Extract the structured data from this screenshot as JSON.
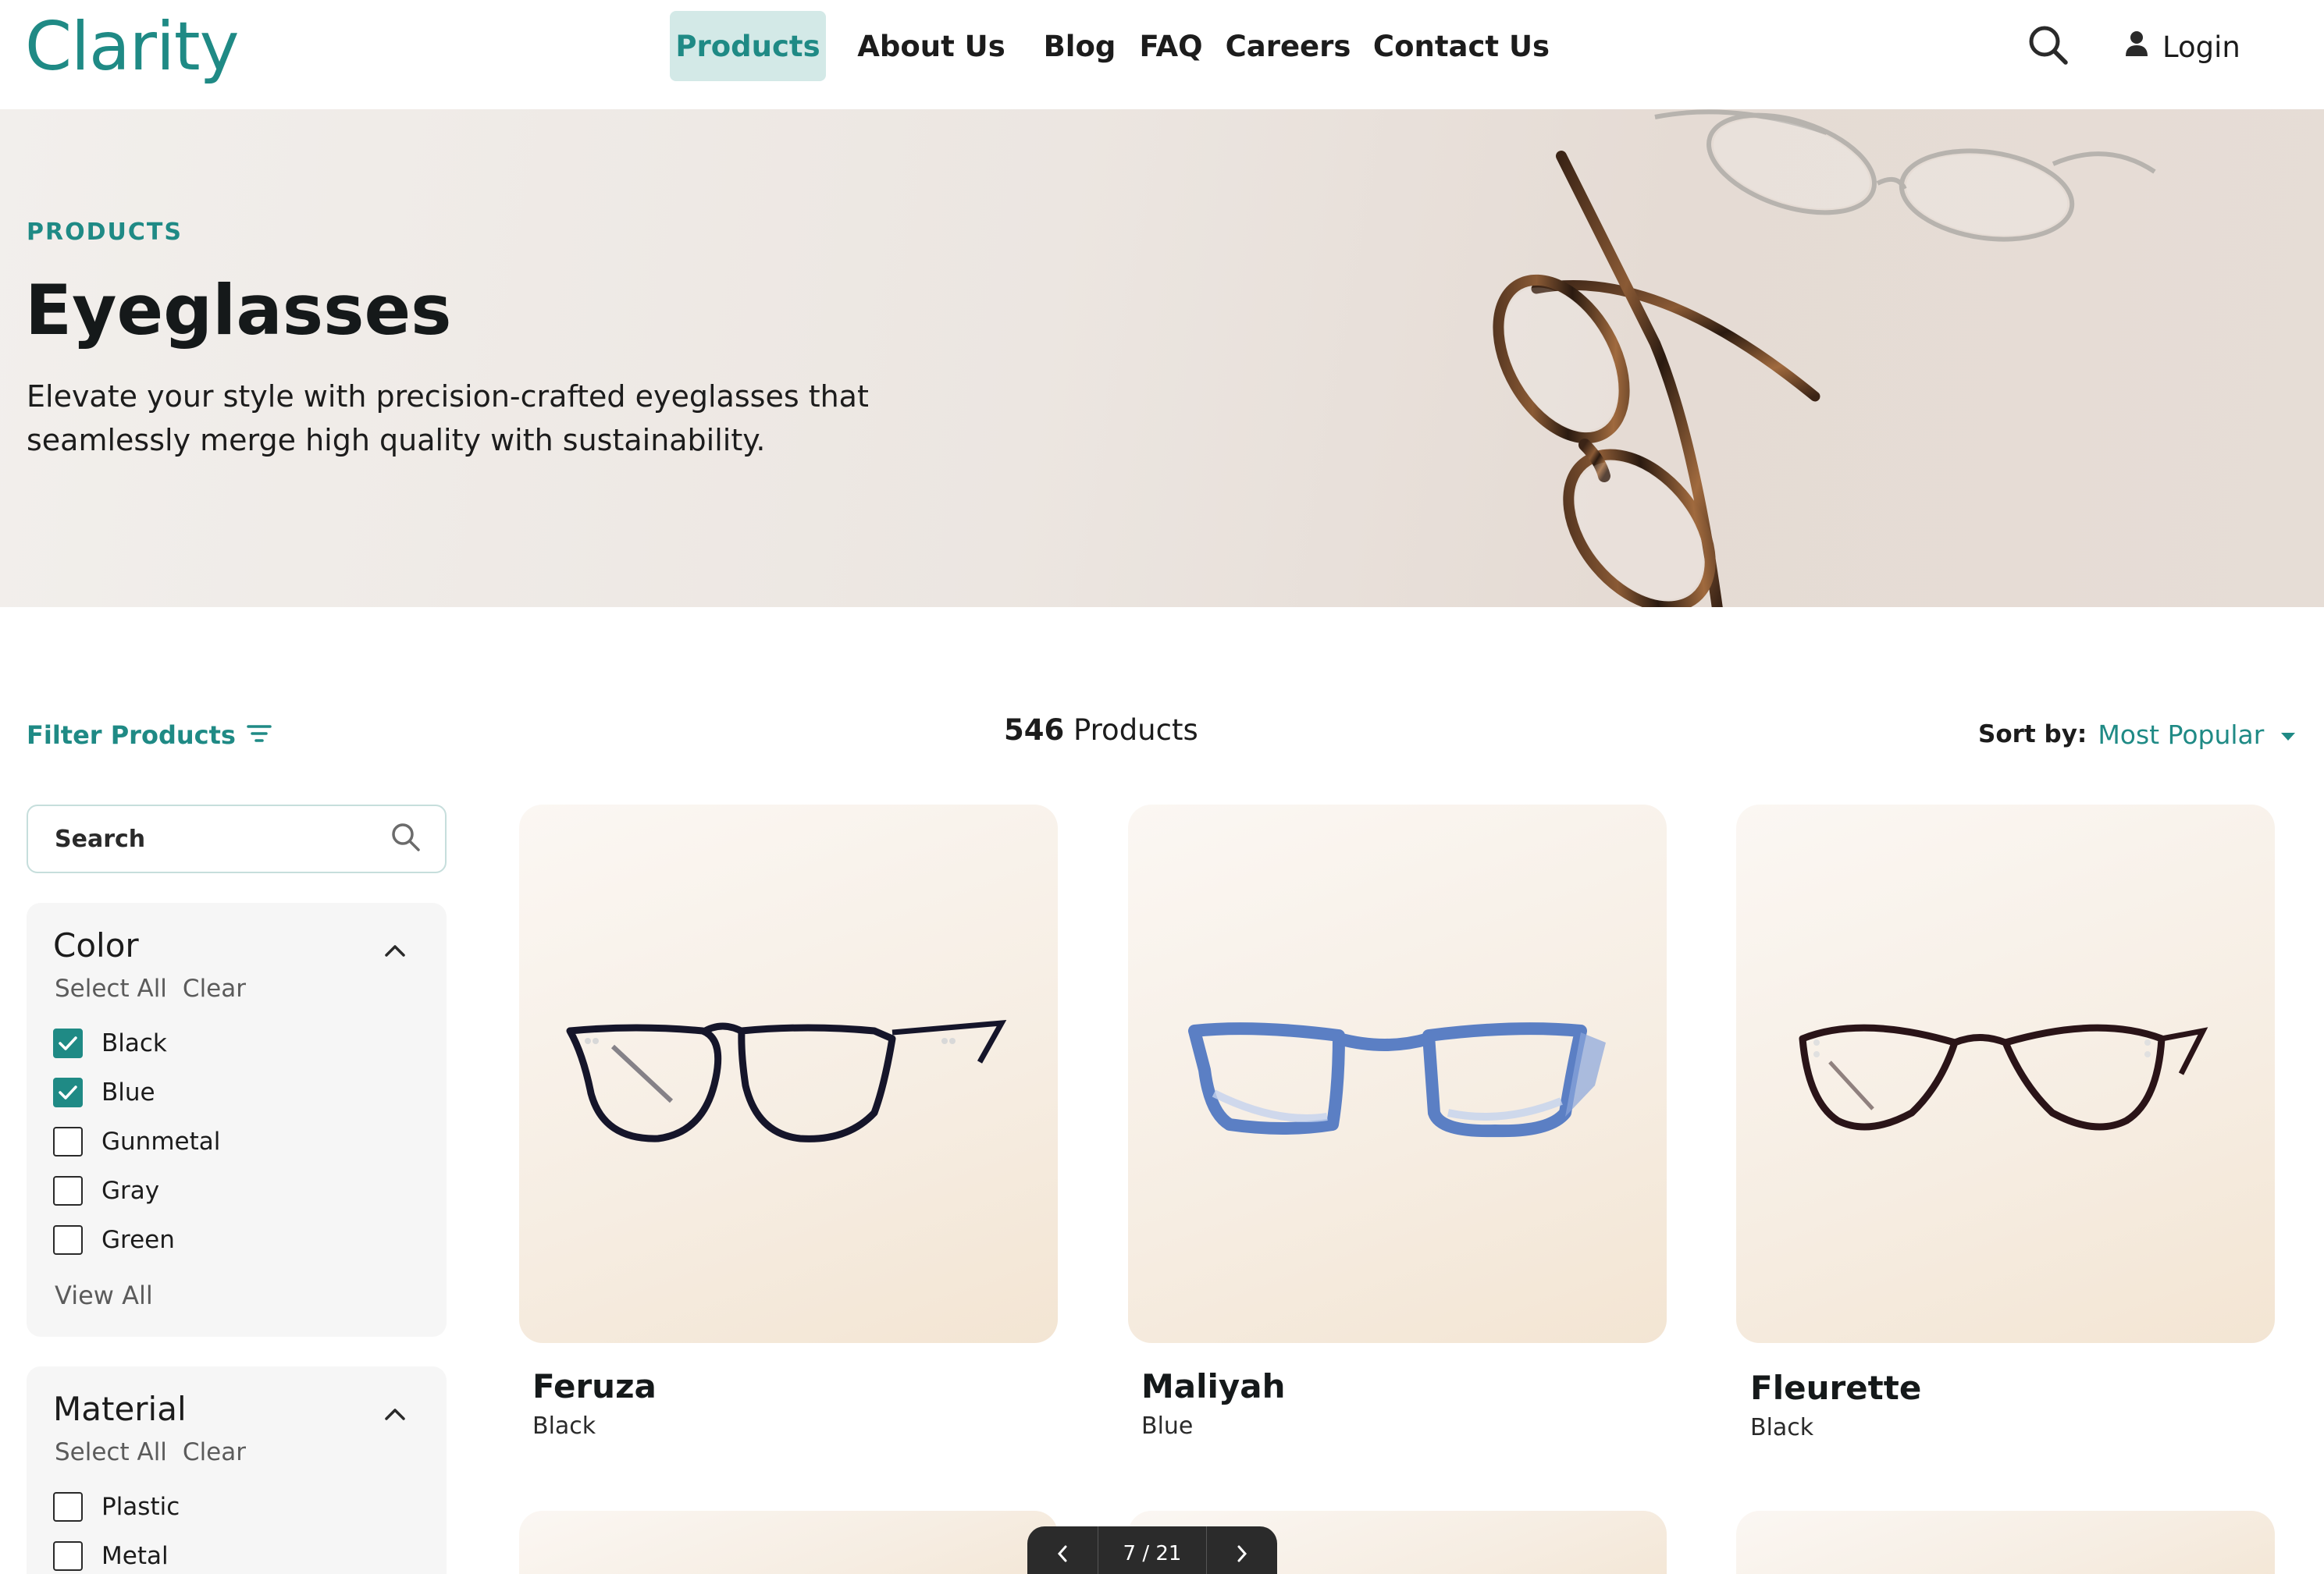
{
  "brand": {
    "logo_text": "Clarity",
    "accent": "#1f8a85"
  },
  "nav": {
    "items": [
      {
        "label": "Products",
        "active": true
      },
      {
        "label": "About Us",
        "active": false
      },
      {
        "label": "Blog",
        "active": false
      },
      {
        "label": "FAQ",
        "active": false
      },
      {
        "label": "Careers",
        "active": false
      },
      {
        "label": "Contact Us",
        "active": false
      }
    ],
    "search_icon": "search-icon",
    "login_label": "Login",
    "login_icon": "user-icon"
  },
  "hero": {
    "eyebrow": "PRODUCTS",
    "title": "Eyeglasses",
    "description": "Elevate your style with precision-crafted eyeglasses that seamlessly merge high quality with sustainability."
  },
  "toolbar": {
    "filter_label": "Filter Products",
    "filter_icon": "filter-lines-icon",
    "count_number": "546",
    "count_suffix": "Products",
    "sort_label": "Sort by:",
    "sort_value": "Most Popular"
  },
  "sidebar": {
    "search_placeholder": "Search",
    "facets": [
      {
        "title": "Color",
        "select_all": "Select All",
        "clear": "Clear",
        "options": [
          {
            "label": "Black",
            "checked": true
          },
          {
            "label": "Blue",
            "checked": true
          },
          {
            "label": "Gunmetal",
            "checked": false
          },
          {
            "label": "Gray",
            "checked": false
          },
          {
            "label": "Green",
            "checked": false
          }
        ],
        "view_all": "View All"
      },
      {
        "title": "Material",
        "select_all": "Select All",
        "clear": "Clear",
        "options": [
          {
            "label": "Plastic",
            "checked": false
          },
          {
            "label": "Metal",
            "checked": false
          }
        ]
      }
    ]
  },
  "products": [
    {
      "name": "Feruza",
      "color": "Black",
      "frame_color": "#15152a"
    },
    {
      "name": "Maliyah",
      "color": "Blue",
      "frame_color": "#5b7fc4"
    },
    {
      "name": "Fleurette",
      "color": "Black",
      "frame_color": "#2a1418"
    }
  ],
  "pager": {
    "text": "7 / 21"
  }
}
